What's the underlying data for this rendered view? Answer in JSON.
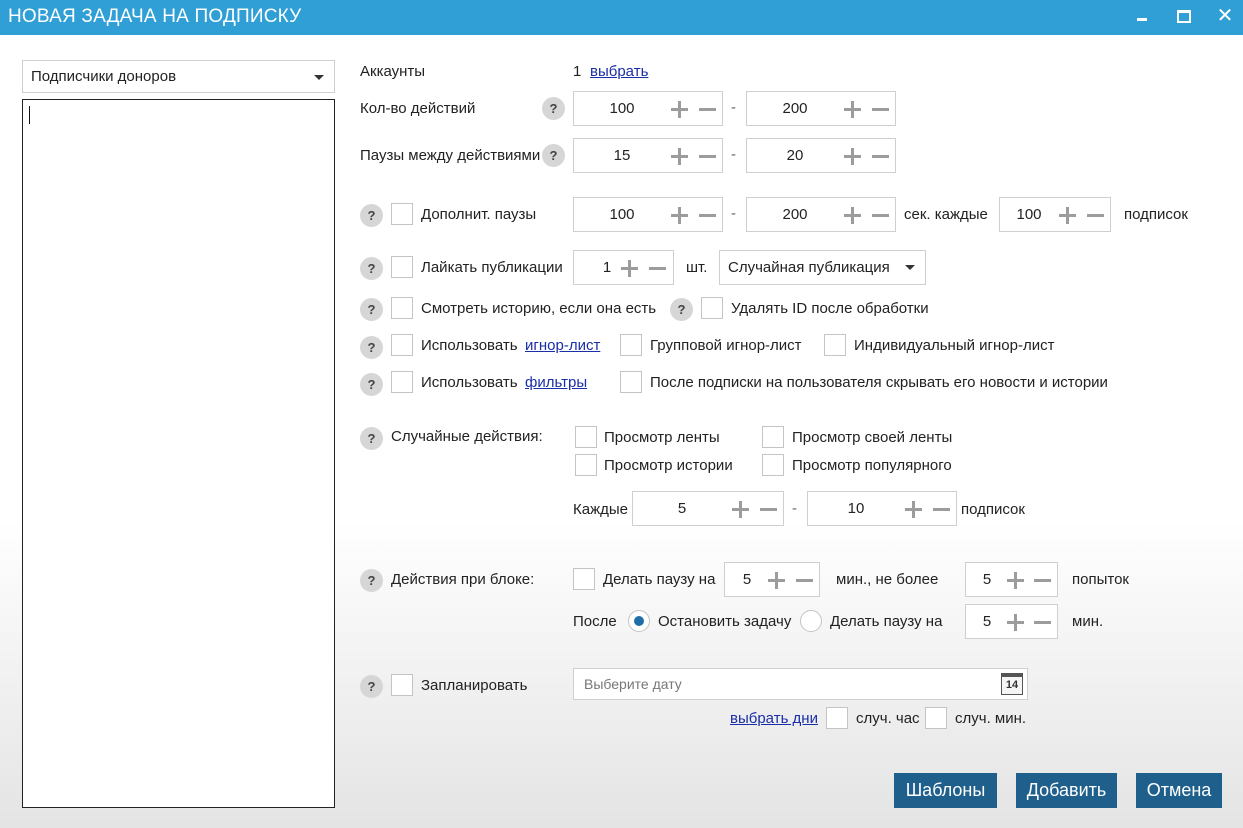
{
  "window": {
    "title": "НОВАЯ ЗАДАЧА НА ПОДПИСКУ",
    "min_icon": "minimize-icon",
    "max_icon": "maximize-icon",
    "close_glyph": "✕"
  },
  "source": {
    "selected": "Подписчики доноров"
  },
  "accounts": {
    "label": "Аккаунты",
    "count": "1",
    "link": "выбрать"
  },
  "actions_count": {
    "label": "Кол-во действий",
    "from": "100",
    "to": "200"
  },
  "pauses": {
    "label": "Паузы между действиями",
    "from": "15",
    "to": "20"
  },
  "extra_pauses": {
    "label": "Дополнит. паузы",
    "from": "100",
    "to": "200",
    "every_label": "сек. каждые",
    "every": "100",
    "unit": "подписок"
  },
  "like": {
    "label": "Лайкать публикации",
    "count": "1",
    "unit": "шт.",
    "mode": "Случайная публикация"
  },
  "story": {
    "label": "Смотреть историю, если она есть",
    "delete_label": "Удалять ID после обработки"
  },
  "ignore": {
    "use_label": "Использовать",
    "link": "игнор-лист",
    "group": "Групповой игнор-лист",
    "individual": "Индивидуальный игнор-лист"
  },
  "filters": {
    "use_label": "Использовать",
    "link": "фильтры",
    "hide": "После подписки на пользователя скрывать его новости и истории"
  },
  "random": {
    "label": "Случайные действия:",
    "feed": "Просмотр ленты",
    "own_feed": "Просмотр своей ленты",
    "stories": "Просмотр истории",
    "popular": "Просмотр популярного",
    "every_label": "Каждые",
    "from": "5",
    "to": "10",
    "unit": "подписок"
  },
  "block": {
    "label": "Действия при блоке:",
    "pause_label": "Делать паузу на",
    "pause": "5",
    "max_label": "мин., не более",
    "tries": "5",
    "tries_unit": "попыток",
    "after_label": "После",
    "stop_label": "Остановить задачу",
    "pause2_label": "Делать паузу на",
    "pause2": "5",
    "min_unit": "мин."
  },
  "schedule": {
    "label": "Запланировать",
    "placeholder": "Выберите дату",
    "calendar_day": "14",
    "days_link": "выбрать дни",
    "rand_hour": "случ. час",
    "rand_min": "случ. мин."
  },
  "buttons": {
    "templates": "Шаблоны",
    "add": "Добавить",
    "cancel": "Отмена"
  },
  "colors": {
    "titlebar": "#2f9fd6",
    "button": "#1f5f8b",
    "link": "#1a2ea8",
    "radio_on": "#1e6fa8"
  }
}
